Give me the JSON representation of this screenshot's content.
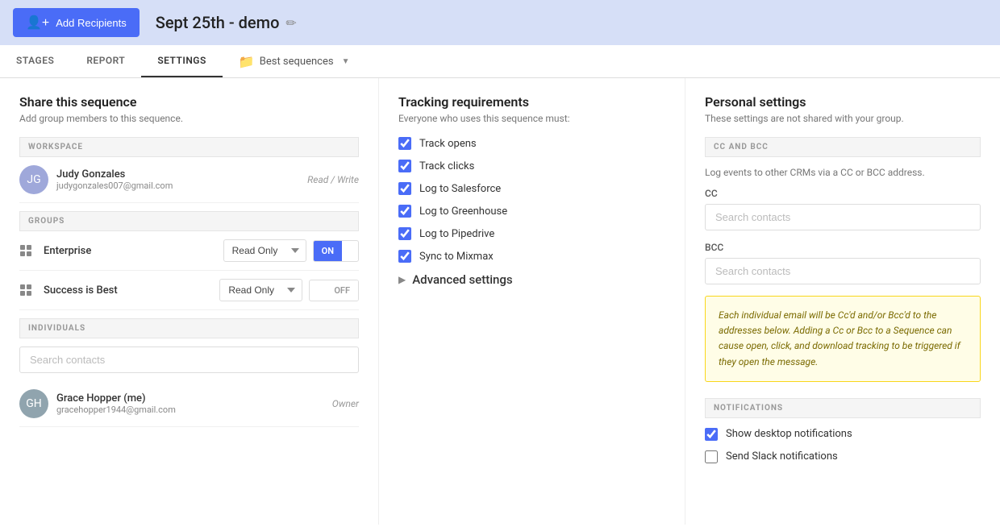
{
  "header": {
    "add_recipients_label": "Add Recipients",
    "sequence_title": "Sept 25th - demo",
    "edit_icon": "✏"
  },
  "tabs": {
    "items": [
      {
        "id": "stages",
        "label": "STAGES",
        "active": false
      },
      {
        "id": "report",
        "label": "REPORT",
        "active": false
      },
      {
        "id": "settings",
        "label": "SETTINGS",
        "active": true
      }
    ],
    "folder": {
      "label": "Best sequences",
      "icon": "📁"
    }
  },
  "share": {
    "title": "Share this sequence",
    "description": "Add group members to this sequence.",
    "workspace_header": "WORKSPACE",
    "groups_header": "GROUPS",
    "individuals_header": "INDIVIDUALS",
    "members": [
      {
        "name": "Judy Gonzales",
        "email": "judygonzales007@gmail.com",
        "role": "Read / Write",
        "initials": "JG"
      }
    ],
    "groups": [
      {
        "name": "Enterprise",
        "permission": "Read Only",
        "toggle": "ON"
      },
      {
        "name": "Success is Best",
        "permission": "Read Only",
        "toggle": "OFF"
      }
    ],
    "search_placeholder": "Search contacts",
    "individual_member": {
      "name": "Grace Hopper (me)",
      "email": "gracehopper1944@gmail.com",
      "role": "Owner",
      "initials": "GH"
    }
  },
  "tracking": {
    "title": "Tracking requirements",
    "description": "Everyone who uses this sequence must:",
    "items": [
      {
        "id": "track_opens",
        "label": "Track opens",
        "checked": true
      },
      {
        "id": "track_clicks",
        "label": "Track clicks",
        "checked": true
      },
      {
        "id": "log_salesforce",
        "label": "Log to Salesforce",
        "checked": true
      },
      {
        "id": "log_greenhouse",
        "label": "Log to Greenhouse",
        "checked": true
      },
      {
        "id": "log_pipedrive",
        "label": "Log to Pipedrive",
        "checked": true
      },
      {
        "id": "sync_mixmax",
        "label": "Sync to Mixmax",
        "checked": true
      }
    ],
    "advanced_settings": "Advanced settings"
  },
  "personal": {
    "title": "Personal settings",
    "description": "These settings are not shared with your group.",
    "cc_bcc": {
      "header": "CC AND BCC",
      "description": "Log events to other CRMs via a CC or BCC address.",
      "cc_label": "CC",
      "bcc_label": "BCC",
      "cc_placeholder": "Search contacts",
      "bcc_placeholder": "Search contacts",
      "warning": "Each individual email will be Cc'd and/or Bcc'd to the addresses below. Adding a Cc or Bcc to a Sequence can cause open, click, and download tracking to be triggered if they open the message."
    },
    "notifications": {
      "header": "NOTIFICATIONS",
      "items": [
        {
          "id": "desktop_notif",
          "label": "Show desktop notifications",
          "checked": true
        },
        {
          "id": "slack_notif",
          "label": "Send Slack notifications",
          "checked": false
        }
      ]
    }
  }
}
